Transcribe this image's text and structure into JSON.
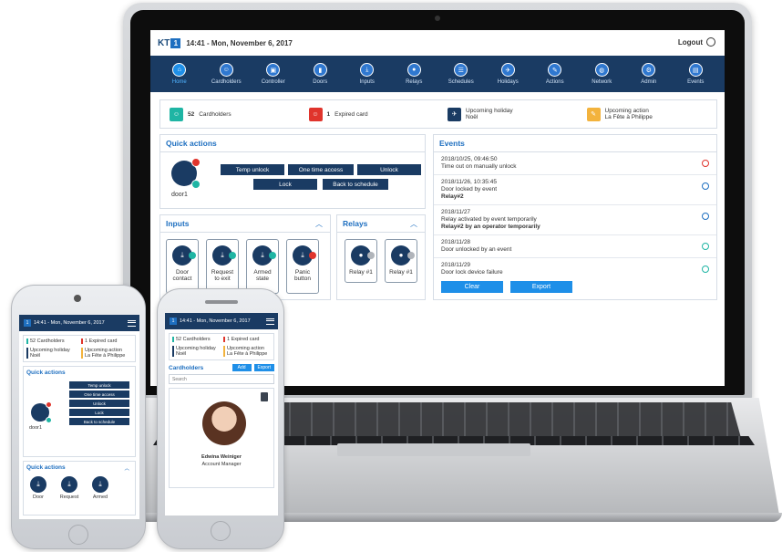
{
  "laptop": {
    "logo": "KT",
    "logo_badge": "1",
    "datetime": "14:41 - Mon, November 6, 2017",
    "logout": "Logout",
    "nav": [
      {
        "label": "Home",
        "icon": "home-icon",
        "active": true
      },
      {
        "label": "Cardholders",
        "icon": "people-icon"
      },
      {
        "label": "Controller",
        "icon": "controller-icon"
      },
      {
        "label": "Doors",
        "icon": "door-icon"
      },
      {
        "label": "Inputs",
        "icon": "input-icon"
      },
      {
        "label": "Relays",
        "icon": "bulb-icon"
      },
      {
        "label": "Schedules",
        "icon": "schedule-icon"
      },
      {
        "label": "Holidays",
        "icon": "plane-icon"
      },
      {
        "label": "Actions",
        "icon": "action-icon"
      },
      {
        "label": "Network",
        "icon": "globe-icon"
      },
      {
        "label": "Admin",
        "icon": "gears-icon"
      },
      {
        "label": "Events",
        "icon": "clipboard-icon"
      }
    ],
    "summary": {
      "cardholders_count": "52",
      "cardholders_label": "Cardholders",
      "expired_count": "1",
      "expired_label": "Expired card",
      "holiday_label": "Upcoming holiday",
      "holiday_name": "Noël",
      "action_label": "Upcoming action",
      "action_name": "La Fête à Philippe"
    },
    "quick_actions": {
      "title": "Quick actions",
      "door_name": "door1",
      "buttons": [
        "Temp unlock",
        "One time access",
        "Unlock",
        "Lock",
        "Back to schedule"
      ]
    },
    "inputs": {
      "title": "Inputs",
      "tiles": [
        {
          "line1": "Door",
          "line2": "contact",
          "status": "#1fb5a4"
        },
        {
          "line1": "Request",
          "line2": "to exit",
          "status": "#1fb5a4"
        },
        {
          "line1": "Armed",
          "line2": "state",
          "status": "#1fb5a4"
        },
        {
          "line1": "Panic",
          "line2": "button",
          "status": "#e0342c"
        }
      ]
    },
    "relays": {
      "title": "Relays",
      "tiles": [
        {
          "label": "Relay #1"
        },
        {
          "label": "Relay #1"
        }
      ]
    },
    "events": {
      "title": "Events",
      "items": [
        {
          "date": "2018/10/25, 09:46:50",
          "text": "Time out on manually unlock",
          "bold": ""
        },
        {
          "date": "2018/11/26, 10:35:45",
          "text": "Door locked by event",
          "bold": "Relay#2"
        },
        {
          "date": "2018/11/27",
          "text": "Relay activated by event temporarily",
          "bold": "Relay#2 by an operator temporarily"
        },
        {
          "date": "2018/11/28",
          "text": "Door unlocked by an event",
          "bold": ""
        },
        {
          "date": "2018/11/29",
          "text": "Door lock device failure",
          "bold": ""
        }
      ],
      "clear": "Clear",
      "export": "Export"
    }
  },
  "phone_left": {
    "datetime": "14:41 - Mon, November 6, 2017",
    "cardholders": "52 Cardholders",
    "expired": "1 Expired card",
    "holiday_label": "Upcoming holiday",
    "holiday_name": "Noël",
    "action_label": "Upcoming action",
    "action_name": "La Fête à Philippe",
    "quick_actions_title": "Quick actions",
    "door_name": "door1",
    "buttons": [
      "Temp unlock",
      "One time access",
      "Unlock",
      "Lock",
      "Back to schedule"
    ],
    "section2_title": "Quick actions",
    "tiles": [
      "Door",
      "Request",
      "Armed"
    ]
  },
  "phone_right": {
    "datetime": "14:41 - Mon, November 6, 2017",
    "cardholders": "52 Cardholders",
    "expired": "1 Expired card",
    "holiday_label": "Upcoming holiday",
    "holiday_name": "Noël",
    "action_label": "Upcoming action",
    "action_name": "La Fête à Philippe",
    "list_title": "Cardholders",
    "add": "Add",
    "export": "Export",
    "search_placeholder": "Search",
    "person_name": "Edwina Weiniger",
    "person_role": "Account Manager"
  }
}
